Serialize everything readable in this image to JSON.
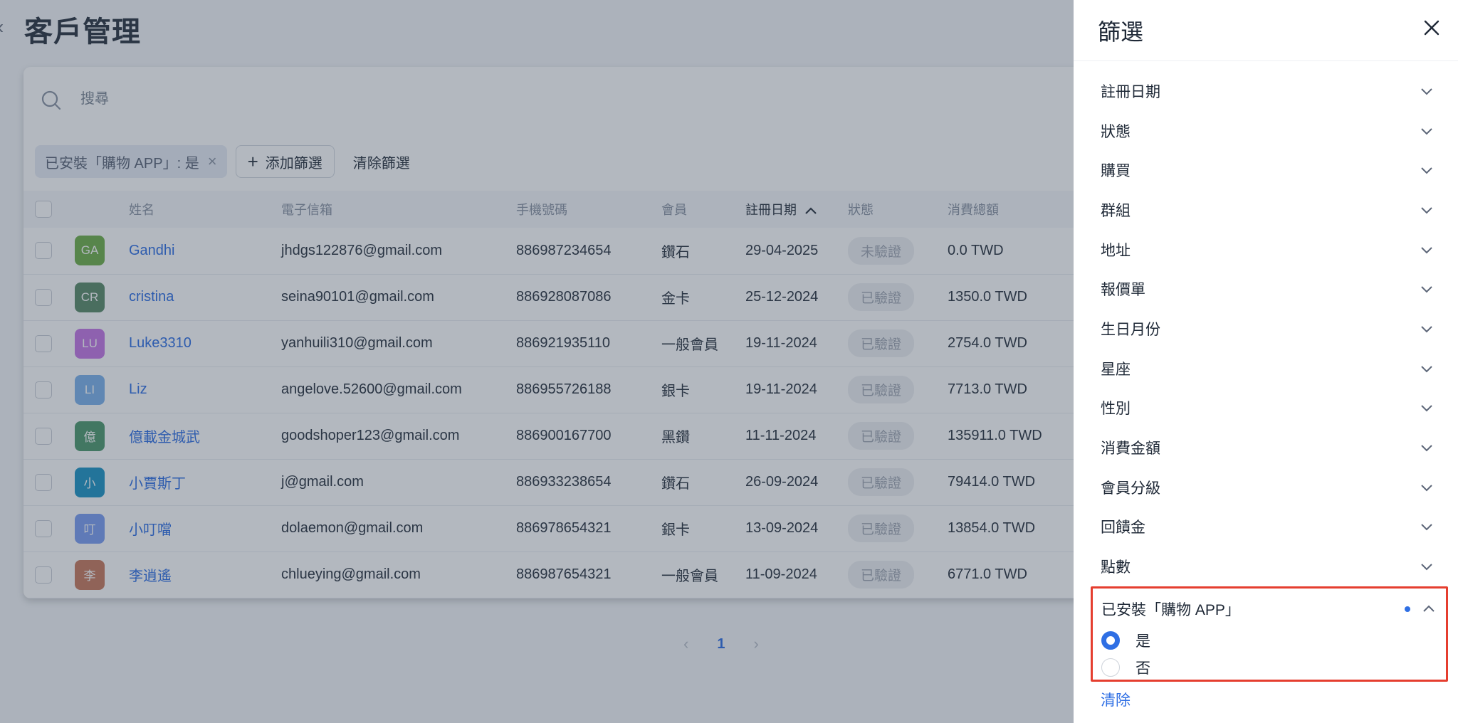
{
  "page": {
    "title": "客戶管理",
    "back_icon": "chevron-left-icon"
  },
  "search": {
    "placeholder": "搜尋",
    "icon": "search-icon"
  },
  "filters_bar": {
    "active_chip": "已安裝「購物 APP」: 是",
    "add_filter": "添加篩選",
    "clear_filters": "清除篩選"
  },
  "table": {
    "columns": [
      "姓名",
      "電子信箱",
      "手機號碼",
      "會員",
      "註冊日期",
      "狀態",
      "消費總額"
    ],
    "rows": [
      {
        "initials": "GA",
        "avatar_color": "#6fb04a",
        "name": "Gandhi",
        "email": "jhdgs122876@gmail.com",
        "phone": "886987234654",
        "member": "鑽石",
        "date": "29-04-2025",
        "status": "未驗證",
        "total": "0.0 TWD"
      },
      {
        "initials": "CR",
        "avatar_color": "#5b8b6a",
        "name": "cristina",
        "email": "seina90101@gmail.com",
        "phone": "886928087086",
        "member": "金卡",
        "date": "25-12-2024",
        "status": "已驗證",
        "total": "1350.0 TWD"
      },
      {
        "initials": "LU",
        "avatar_color": "#c678e6",
        "name": "Luke3310",
        "email": "yanhuili310@gmail.com",
        "phone": "886921935110",
        "member": "一般會員",
        "date": "19-11-2024",
        "status": "已驗證",
        "total": "2754.0 TWD"
      },
      {
        "initials": "LI",
        "avatar_color": "#7eb3ec",
        "name": "Liz",
        "email": "angelove.52600@gmail.com",
        "phone": "886955726188",
        "member": "銀卡",
        "date": "19-11-2024",
        "status": "已驗證",
        "total": "7713.0 TWD"
      },
      {
        "initials": "億",
        "avatar_color": "#4f9a6e",
        "name": "億載金城武",
        "email": "goodshoper123@gmail.com",
        "phone": "886900167700",
        "member": "黑鑽",
        "date": "11-11-2024",
        "status": "已驗證",
        "total": "135911.0 TWD"
      },
      {
        "initials": "小",
        "avatar_color": "#1f95c6",
        "name": "小賈斯丁",
        "email": "j@gmail.com",
        "phone": "886933238654",
        "member": "鑽石",
        "date": "26-09-2024",
        "status": "已驗證",
        "total": "79414.0 TWD"
      },
      {
        "initials": "叮",
        "avatar_color": "#7c9ef2",
        "name": "小叮噹",
        "email": "dolaemon@gmail.com",
        "phone": "886978654321",
        "member": "銀卡",
        "date": "13-09-2024",
        "status": "已驗證",
        "total": "13854.0 TWD"
      },
      {
        "initials": "李",
        "avatar_color": "#c97a5e",
        "name": "李逍遙",
        "email": "chlueying@gmail.com",
        "phone": "886987654321",
        "member": "一般會員",
        "date": "11-09-2024",
        "status": "已驗證",
        "total": "6771.0 TWD"
      }
    ]
  },
  "pagination": {
    "current": "1",
    "prev_icon": "chevron-left-icon",
    "next_icon": "chevron-right-icon"
  },
  "drawer": {
    "title": "篩選",
    "close_icon": "close-icon",
    "items": [
      "註冊日期",
      "狀態",
      "購買",
      "群組",
      "地址",
      "報價單",
      "生日月份",
      "星座",
      "性別",
      "消費金額",
      "會員分級",
      "回饋金",
      "點數"
    ],
    "expanded": {
      "label": "已安裝「購物 APP」",
      "options": [
        {
          "label": "是",
          "selected": true
        },
        {
          "label": "否",
          "selected": false
        }
      ]
    },
    "clear": "清除"
  },
  "colors": {
    "accent": "#2f6fe4",
    "highlight_border": "#e53e2f",
    "overlay": "rgba(45,58,78,0.36)"
  }
}
